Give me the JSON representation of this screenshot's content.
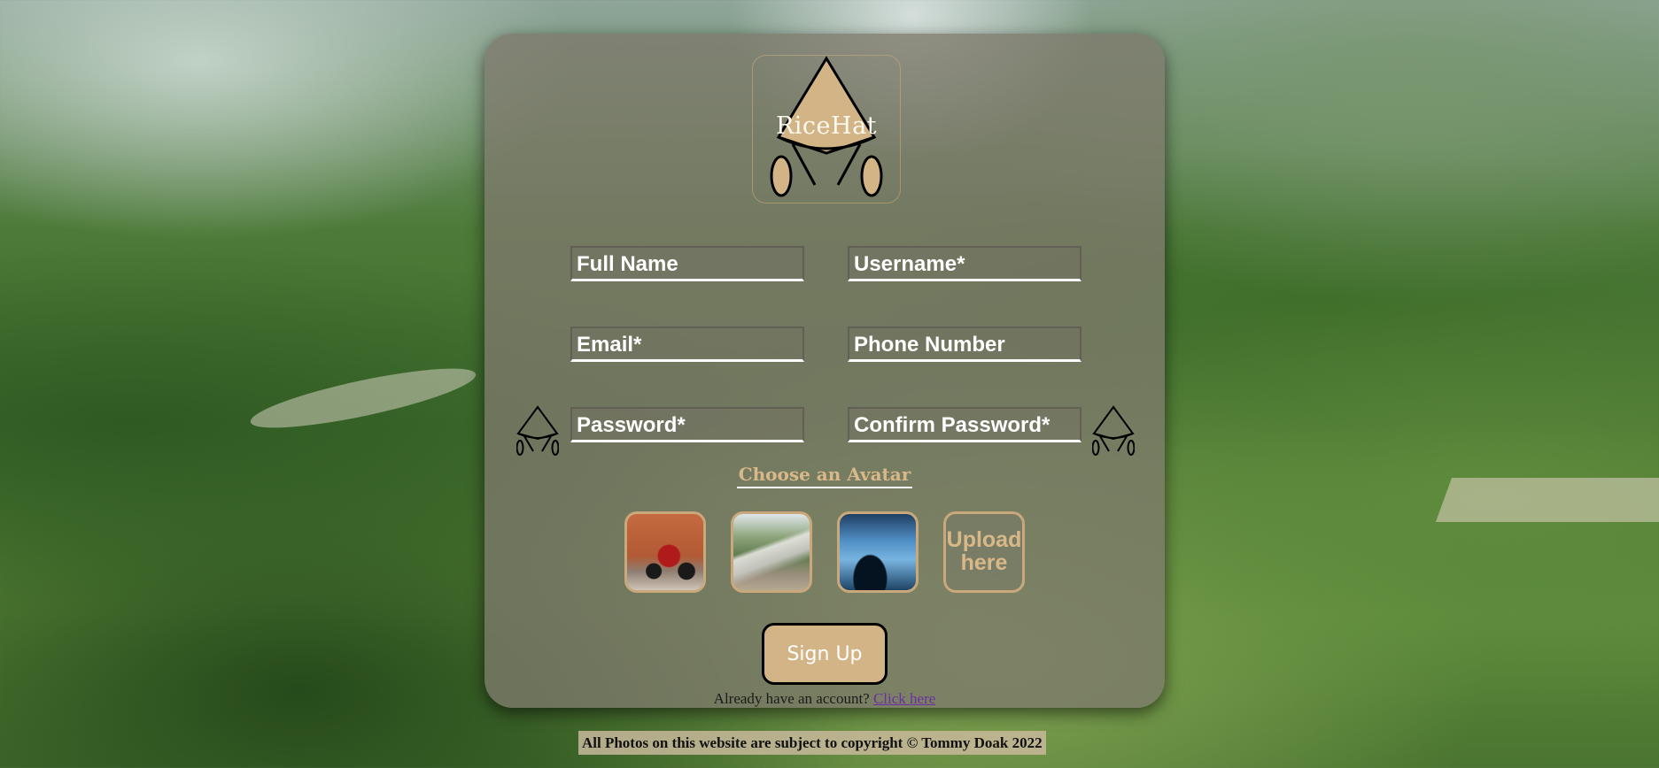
{
  "logo": {
    "text": "RiceHat",
    "icon": "rice-hat-logo-icon"
  },
  "form": {
    "full_name": {
      "placeholder": "Full Name",
      "value": ""
    },
    "username": {
      "placeholder": "Username*",
      "value": ""
    },
    "email": {
      "placeholder": "Email*",
      "value": ""
    },
    "phone": {
      "placeholder": "Phone Number",
      "value": ""
    },
    "password": {
      "placeholder": "Password*",
      "value": ""
    },
    "confirm_password": {
      "placeholder": "Confirm Password*",
      "value": ""
    }
  },
  "avatar": {
    "title": "Choose an Avatar",
    "options": [
      {
        "name": "motorbike-avatar-image"
      },
      {
        "name": "waterfall-road-avatar-image"
      },
      {
        "name": "hammock-beach-avatar-image"
      }
    ],
    "upload_label": "Upload here"
  },
  "signup_label": "Sign Up",
  "login": {
    "prompt": "Already have an account?",
    "link": "Click here"
  },
  "footer": {
    "copyright": "All Photos on this website are subject to copyright © Tommy Doak 2022"
  },
  "colors": {
    "accent": "#d3b487",
    "card": "#7d7a6c",
    "link": "#6a2fa0"
  }
}
